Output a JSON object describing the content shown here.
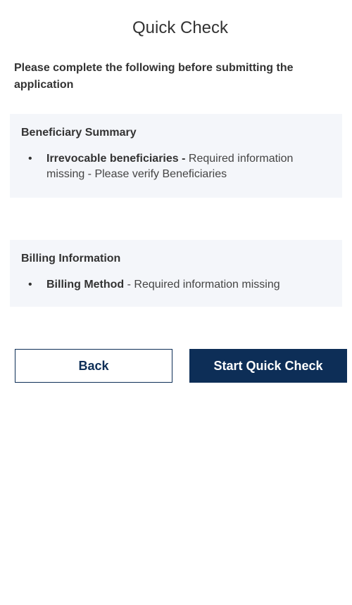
{
  "page": {
    "title": "Quick Check",
    "intro": "Please complete the following before submitting the application"
  },
  "sections": [
    {
      "title": "Beneficiary Summary",
      "items": [
        {
          "bullet": "•",
          "label": "Irrevocable beneficiaries -",
          "detail": " Required information missing - Please verify Beneficiaries"
        }
      ]
    },
    {
      "title": "Billing Information",
      "items": [
        {
          "bullet": "•",
          "label": "Billing Method",
          "detail": " - Required information missing"
        }
      ]
    }
  ],
  "buttons": {
    "back_label": "Back",
    "start_label": "Start Quick Check"
  },
  "colors": {
    "primary": "#0d2e57",
    "card_background": "#f4f6fa",
    "text": "#333333"
  }
}
